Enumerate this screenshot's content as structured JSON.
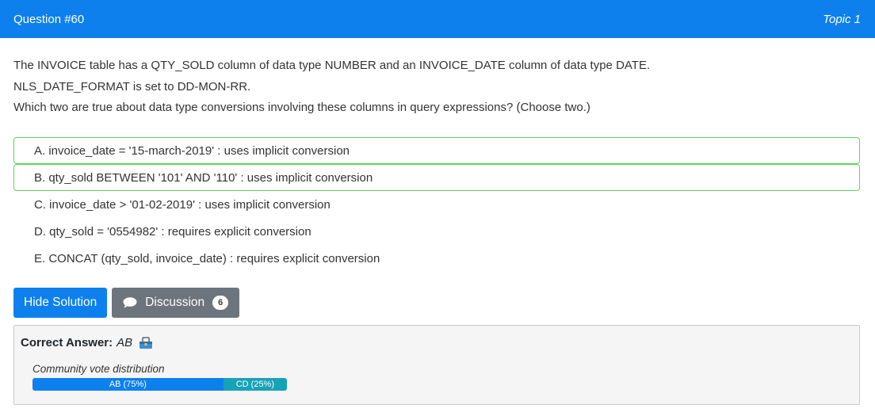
{
  "header": {
    "question_number": "Question #60",
    "topic": "Topic 1"
  },
  "question": {
    "lines": [
      "The INVOICE table has a QTY_SOLD column of data type NUMBER and an INVOICE_DATE column of data type DATE.",
      "NLS_DATE_FORMAT is set to DD-MON-RR.",
      "Which two are true about data type conversions involving these columns in query expressions? (Choose two.)"
    ]
  },
  "choices": [
    {
      "text": "A. invoice_date = '15-march-2019' : uses implicit conversion",
      "correct": true
    },
    {
      "text": "B. qty_sold BETWEEN '101' AND '110' : uses implicit conversion",
      "correct": true
    },
    {
      "text": "C. invoice_date > '01-02-2019' : uses implicit conversion",
      "correct": false
    },
    {
      "text": "D. qty_sold = '0554982' : requires explicit conversion",
      "correct": false
    },
    {
      "text": "E. CONCAT (qty_sold, invoice_date) : requires explicit conversion",
      "correct": false
    }
  ],
  "buttons": {
    "hide_solution": "Hide Solution",
    "discussion": "Discussion",
    "discussion_count": "6"
  },
  "answer": {
    "label": "Correct Answer:",
    "value": "AB",
    "icon": "toolbox-icon"
  },
  "vote": {
    "title": "Community vote distribution",
    "segments": [
      {
        "label": "AB (75%)",
        "percent": 75,
        "color": "#0d80ee"
      },
      {
        "label": "CD (25%)",
        "percent": 25,
        "color": "#17a2b8"
      }
    ]
  },
  "colors": {
    "primary": "#0d80ee",
    "secondary": "#6c757d",
    "correct_border": "#5fd35f"
  }
}
